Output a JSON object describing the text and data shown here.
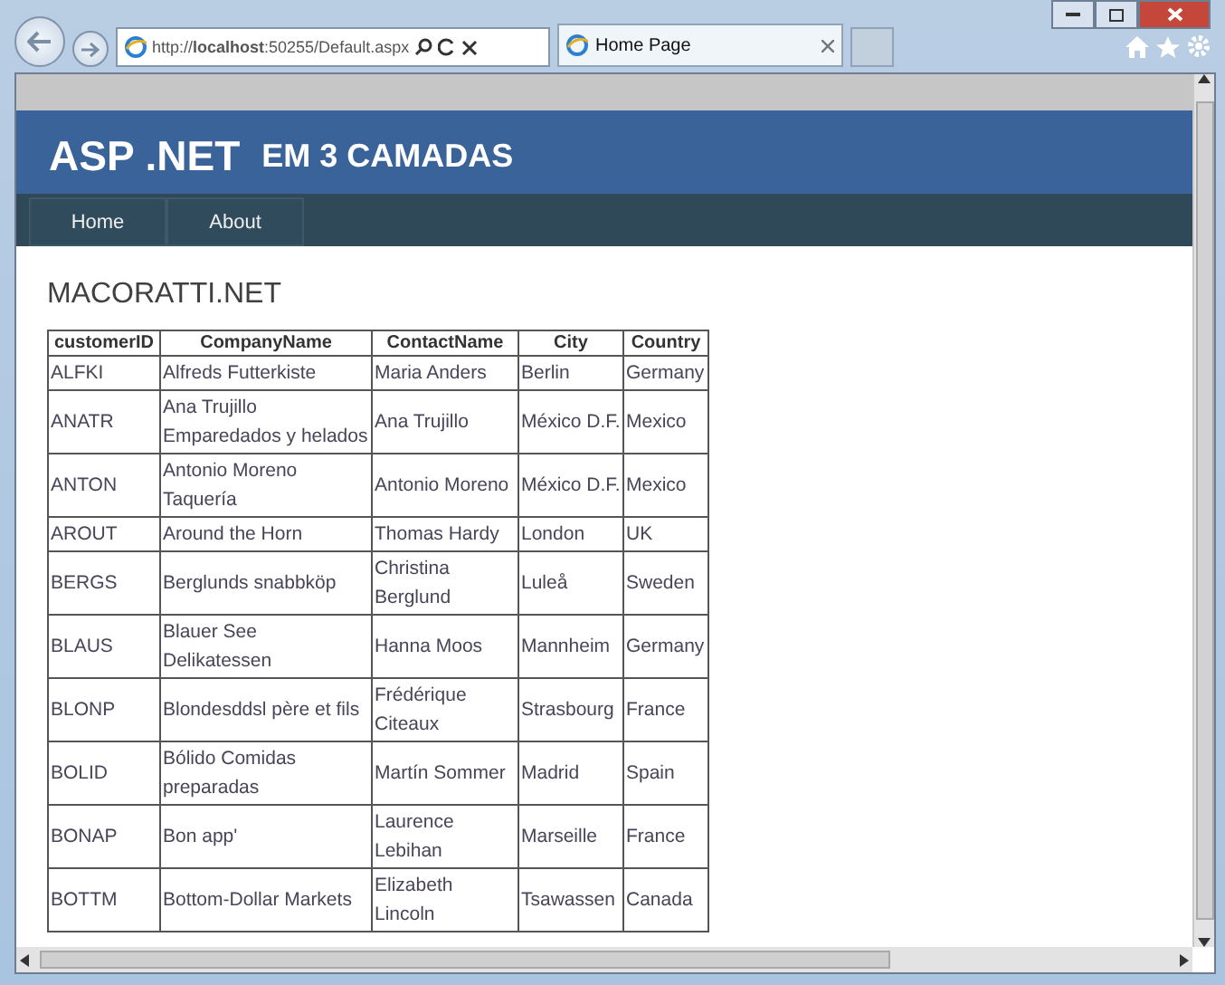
{
  "browser": {
    "address": "http://**localhost**:50255/Default.aspx",
    "tab": "Home Page"
  },
  "header": {
    "title": "ASP .NET",
    "subtitle": "EM 3 CAMADAS"
  },
  "nav": [
    "Home",
    "About"
  ],
  "heading": "MACORATTI.NET",
  "table": {
    "columns": [
      "customerID",
      "CompanyName",
      "ContactName",
      "City",
      "Country"
    ],
    "rows": [
      [
        "ALFKI",
        "Alfreds Futterkiste",
        "Maria Anders",
        "Berlin",
        "Germany"
      ],
      [
        "ANATR",
        "Ana Trujillo Emparedados y helados",
        "Ana Trujillo",
        "México D.F.",
        "Mexico"
      ],
      [
        "ANTON",
        "Antonio Moreno Taquería",
        "Antonio Moreno",
        "México D.F.",
        "Mexico"
      ],
      [
        "AROUT",
        "Around the Horn",
        "Thomas Hardy",
        "London",
        "UK"
      ],
      [
        "BERGS",
        "Berglunds snabbköp",
        "Christina Berglund",
        "Luleå",
        "Sweden"
      ],
      [
        "BLAUS",
        "Blauer See Delikatessen",
        "Hanna Moos",
        "Mannheim",
        "Germany"
      ],
      [
        "BLONP",
        "Blondesddsl père et fils",
        "Frédérique Citeaux",
        "Strasbourg",
        "France"
      ],
      [
        "BOLID",
        "Bólido Comidas preparadas",
        "Martín Sommer",
        "Madrid",
        "Spain"
      ],
      [
        "BONAP",
        "Bon app'",
        "Laurence Lebihan",
        "Marseille",
        "France"
      ],
      [
        "BOTTM",
        "Bottom-Dollar Markets",
        "Elizabeth Lincoln",
        "Tsawassen",
        "Canada"
      ]
    ]
  }
}
